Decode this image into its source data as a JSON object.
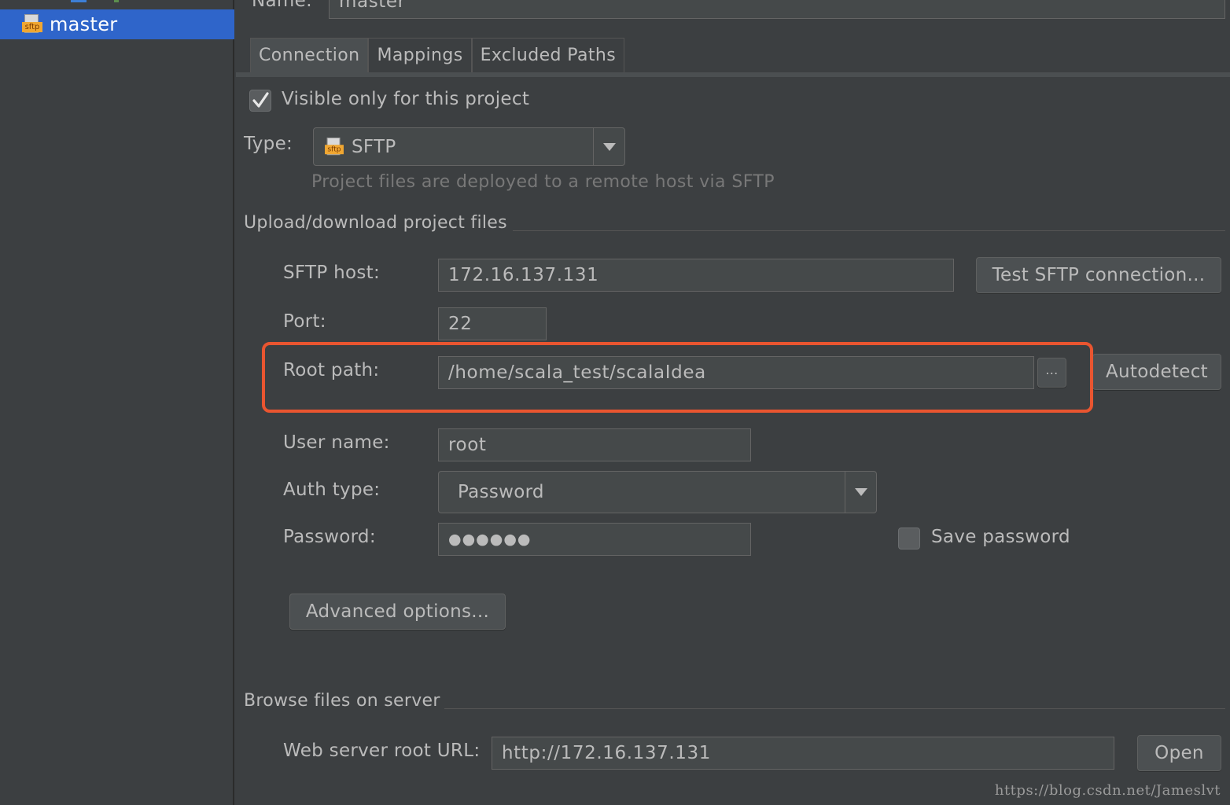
{
  "sidebar": {
    "items": [
      {
        "label": "master",
        "icon": "sftp-icon",
        "icon_text": "sftp",
        "selected": true
      }
    ]
  },
  "name": {
    "label": "Name:",
    "value": "master"
  },
  "tabs": [
    {
      "label": "Connection",
      "active": true
    },
    {
      "label": "Mappings",
      "active": false
    },
    {
      "label": "Excluded Paths",
      "active": false
    }
  ],
  "visible_only": {
    "label": "Visible only for this project",
    "checked": true
  },
  "type": {
    "label": "Type:",
    "value": "SFTP",
    "icon_text": "sftp",
    "hint": "Project files are deployed to a remote host via SFTP"
  },
  "upload_section": {
    "title": "Upload/download project files",
    "sftp_host": {
      "label": "SFTP host:",
      "value": "172.16.137.131"
    },
    "test_button": "Test SFTP connection...",
    "port": {
      "label": "Port:",
      "value": "22"
    },
    "root_path": {
      "label": "Root path:",
      "value": "/home/scala_test/scalaIdea",
      "browse_label": "..."
    },
    "autodetect_button": "Autodetect",
    "user_name": {
      "label": "User name:",
      "value": "root"
    },
    "auth_type": {
      "label": "Auth type:",
      "value": "Password"
    },
    "password": {
      "label": "Password:",
      "value": "●●●●●●"
    },
    "save_password": {
      "label": "Save password",
      "checked": false
    },
    "advanced_button": "Advanced options..."
  },
  "browse_section": {
    "title": "Browse files on server",
    "web_root": {
      "label": "Web server root URL:",
      "value": "http://172.16.137.131"
    },
    "open_button": "Open"
  },
  "watermark": "https://blog.csdn.net/Jameslvt",
  "colors": {
    "background": "#3c3f41",
    "selection": "#2f65ca",
    "highlight": "#e95530",
    "field": "#45494a",
    "text": "#bbbbbb"
  }
}
